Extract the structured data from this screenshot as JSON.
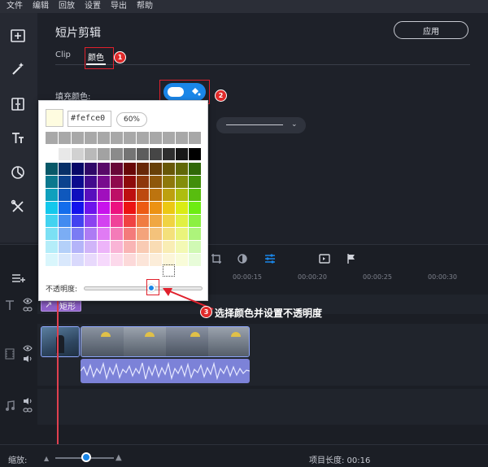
{
  "menu": [
    "文件",
    "编辑",
    "回放",
    "设置",
    "导出",
    "帮助"
  ],
  "panel": {
    "title": "短片剪辑",
    "apply_label": "应用",
    "tabs": [
      {
        "label": "Clip"
      },
      {
        "label": "颜色"
      }
    ],
    "fill_label": "填充颜色:"
  },
  "picker": {
    "hex_value": "#fefce0",
    "opacity_percent": "60%",
    "opacity_label": "不透明度:",
    "opacity_value": 0.6,
    "selected_color": "#fefce0"
  },
  "callouts": {
    "one": "1",
    "two": "2",
    "three": "3"
  },
  "annotation": "选择颜色并设置不透明度",
  "timeline": {
    "ticks": [
      "00:00:15",
      "00:00:20",
      "00:00:25",
      "00:00:30"
    ],
    "title_clip_label": "矩形"
  },
  "status": {
    "zoom_label": "缩放:",
    "project_length": "项目长度: 00:16"
  },
  "colors": {
    "accent": "#1a86e8",
    "callout_red": "#e02a2a",
    "title_clip": "#8e60c8",
    "audio_clip": "#7c82d8"
  }
}
